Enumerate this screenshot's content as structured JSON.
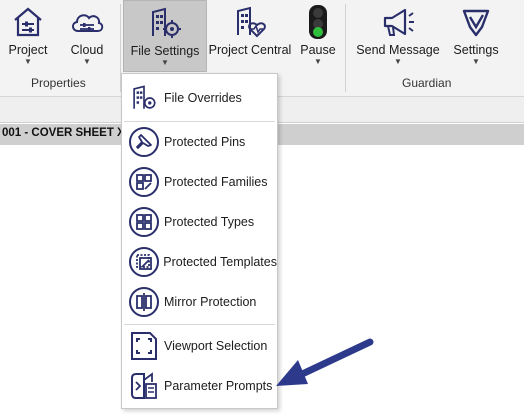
{
  "ribbon": {
    "buttons": [
      {
        "label": "Project",
        "icon": "house-sliders-icon"
      },
      {
        "label": "Cloud",
        "icon": "cloud-sliders-icon"
      },
      {
        "label": "File Settings",
        "icon": "building-gear-icon"
      },
      {
        "label": "Project Central",
        "icon": "building-heart-icon"
      },
      {
        "label": "Pause",
        "icon": "traffic-light-icon"
      },
      {
        "label": "Send Message",
        "icon": "megaphone-icon"
      },
      {
        "label": "Settings",
        "icon": "shield-check-icon"
      }
    ],
    "groups": {
      "properties": "Properties",
      "guardian": "Guardian"
    }
  },
  "view": {
    "tab_title": "001 - COVER SHEET  X"
  },
  "menu": {
    "items": [
      {
        "label": "File Overrides",
        "icon": "building-gear-icon"
      },
      {
        "label": "Protected Pins",
        "icon": "pin-icon"
      },
      {
        "label": "Protected Families",
        "icon": "families-icon"
      },
      {
        "label": "Protected Types",
        "icon": "types-icon"
      },
      {
        "label": "Protected Templates",
        "icon": "templates-icon"
      },
      {
        "label": "Mirror Protection",
        "icon": "mirror-icon"
      },
      {
        "label": "Viewport Selection",
        "icon": "viewport-icon"
      },
      {
        "label": "Parameter Prompts",
        "icon": "parameter-prompts-icon"
      }
    ]
  },
  "colors": {
    "icon_navy": "#2a2f6b",
    "arrow": "#2d3a8c",
    "ribbon_bg": "#f3f3f3",
    "active_bg": "#c8c8c8"
  }
}
